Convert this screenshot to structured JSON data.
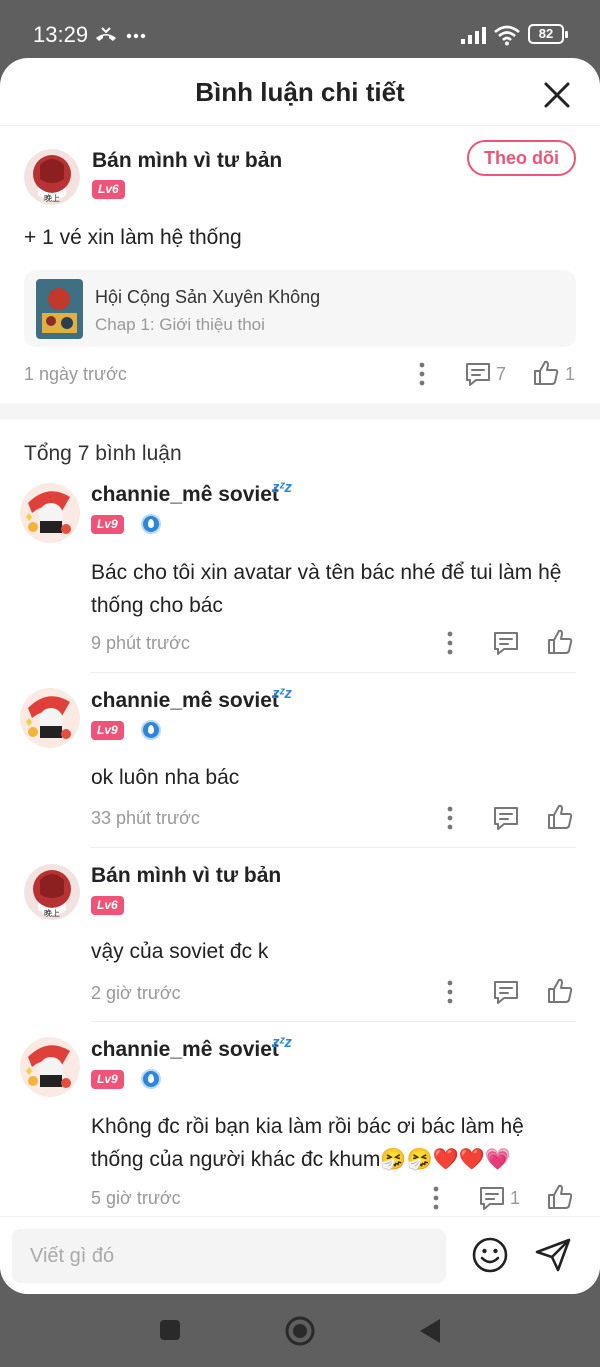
{
  "status_bar": {
    "time": "13:29",
    "battery": "82"
  },
  "header": {
    "title": "Bình luận chi tiết"
  },
  "main_comment": {
    "username": "Bán mình vì tư bản",
    "level": "Lv6",
    "follow_label": "Theo dõi",
    "text": "+ 1 vé xin làm hệ thống",
    "story": {
      "title": "Hội Cộng Sản Xuyên Không",
      "chapter": "Chap 1: Giới thiệu thoi"
    },
    "time": "1 ngày trước",
    "reply_count": "7",
    "like_count": "1"
  },
  "total_label": "Tổng 7 bình luận",
  "replies": [
    {
      "username": "channie_mê soviet",
      "level": "Lv9",
      "text": "Bác cho tôi xin avatar và tên bác nhé để tui làm hệ thống cho bác",
      "time": "9 phút trước"
    },
    {
      "username": "channie_mê soviet",
      "level": "Lv9",
      "text": "ok luôn nha bác",
      "time": "33 phút trước"
    },
    {
      "username": "Bán mình vì tư bản",
      "level": "Lv6",
      "text": "vậy của soviet đc k",
      "time": "2 giờ trước"
    },
    {
      "username": "channie_mê soviet",
      "level": "Lv9",
      "text": "Không đc rồi bạn kia làm rồi bác ơi bác làm hệ thống của người khác đc khum🤧🤧❤️❤️💗",
      "time": "5 giờ trước",
      "reply_count": "1"
    }
  ],
  "input": {
    "placeholder": "Viết gì đó"
  },
  "colors": {
    "accent": "#ef5377",
    "badge_blue": "#2d86d9",
    "muted": "#999999"
  }
}
